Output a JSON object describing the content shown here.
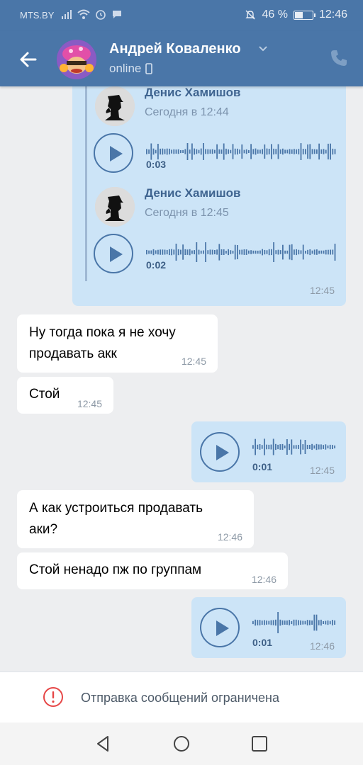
{
  "status_bar": {
    "carrier": "MTS.BY",
    "battery": "46 %",
    "battery_level": 0.46,
    "time": "12:46"
  },
  "header": {
    "contact_name": "Андрей Коваленко",
    "status": "online"
  },
  "messages": {
    "forwarded": {
      "items": [
        {
          "sender": "Денис Хамишов",
          "date": "Сегодня в 12:44",
          "duration": "0:03"
        },
        {
          "sender": "Денис Хамишов",
          "date": "Сегодня в 12:45",
          "duration": "0:02"
        }
      ],
      "time": "12:45"
    },
    "in1": {
      "text_line1": "Ну тогда пока я не хочу",
      "text_line2": "продавать акк",
      "time": "12:45"
    },
    "in2": {
      "text": "Стой",
      "time": "12:45"
    },
    "voice1": {
      "duration": "0:01",
      "time": "12:45"
    },
    "in3": {
      "text_line1": "А как устроиться продавать",
      "text_line2": "аки?",
      "time": "12:46"
    },
    "in4": {
      "text": "Стой ненадо пж по группам",
      "time": "12:46"
    },
    "voice2": {
      "duration": "0:01",
      "time": "12:46"
    }
  },
  "restriction": {
    "text": "Отправка сообщений ограничена"
  },
  "colors": {
    "header_bg": "#4a76a8",
    "chat_bg": "#edeef0",
    "outgoing_bubble": "#cce4f7",
    "incoming_bubble": "#ffffff",
    "alert_red": "#e64646"
  }
}
